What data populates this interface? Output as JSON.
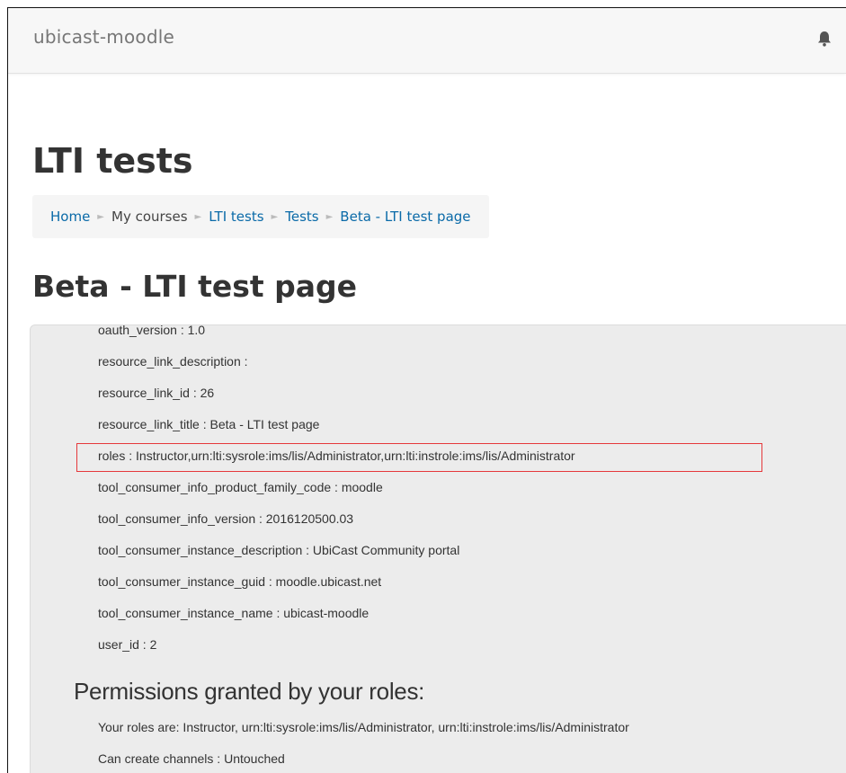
{
  "navbar": {
    "brand": "ubicast-moodle",
    "notification_icon": "bell-icon"
  },
  "page_title": "LTI tests",
  "breadcrumb": [
    {
      "label": "Home",
      "link": true
    },
    {
      "label": "My courses",
      "link": false
    },
    {
      "label": "LTI tests",
      "link": true
    },
    {
      "label": "Tests",
      "link": true
    },
    {
      "label": "Beta - LTI test page",
      "link": true
    }
  ],
  "breadcrumb_separator": "►",
  "activity_title": "Beta - LTI test page",
  "lti_params": [
    "oauth_version : 1.0",
    "resource_link_description :",
    "resource_link_id : 26",
    "resource_link_title : Beta - LTI test page",
    "roles : Instructor,urn:lti:sysrole:ims/lis/Administrator,urn:lti:instrole:ims/lis/Administrator",
    "tool_consumer_info_product_family_code : moodle",
    "tool_consumer_info_version : 2016120500.03",
    "tool_consumer_instance_description : UbiCast Community portal",
    "tool_consumer_instance_guid : moodle.ubicast.net",
    "tool_consumer_instance_name : ubicast-moodle",
    "user_id : 2"
  ],
  "highlight_color": "#e5383b",
  "permissions": {
    "heading": "Permissions granted by your roles:",
    "items": [
      "Your roles are: Instructor, urn:lti:sysrole:ims/lis/Administrator, urn:lti:instrole:ims/lis/Administrator",
      "Can create channels : Untouched"
    ]
  }
}
